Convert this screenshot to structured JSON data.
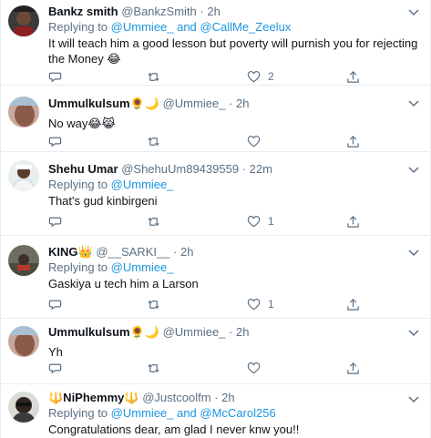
{
  "accent_color": "#1b95e0",
  "tweets": [
    {
      "name": "Bankz smith",
      "handle": "@BankzSmith",
      "dot": "·",
      "time": "2h",
      "replying_prefix": "Replying to ",
      "replying_to_1": "@Ummiee_",
      "replying_and": " and ",
      "replying_to_2": "@CallMe_Zeelux",
      "text": "It will teach him a good lesson but poverty will purnish you for rejecting the Money 😂",
      "reply_count": "",
      "retweet_count": "",
      "like_count": "2"
    },
    {
      "name": "Ummulkulsum🌻🌙",
      "handle": "@Ummiee_",
      "dot": "·",
      "time": "2h",
      "text": "No way😂😹",
      "reply_count": "",
      "retweet_count": "",
      "like_count": ""
    },
    {
      "name": "Shehu Umar",
      "handle": "@ShehuUm89439559",
      "dot": "·",
      "time": "22m",
      "replying_prefix": "Replying to ",
      "replying_to_1": "@Ummiee_",
      "text": "That's gud kinbirgeni",
      "reply_count": "",
      "retweet_count": "",
      "like_count": "1"
    },
    {
      "name": "KING👑",
      "handle": "@__SARKI__",
      "dot": "·",
      "time": "2h",
      "replying_prefix": "Replying to ",
      "replying_to_1": "@Ummiee_",
      "text": "Gaskiya u tech him a Larson",
      "reply_count": "",
      "retweet_count": "",
      "like_count": "1"
    },
    {
      "name": "Ummulkulsum🌻🌙",
      "handle": "@Ummiee_",
      "dot": "·",
      "time": "2h",
      "text": "Yh",
      "reply_count": "",
      "retweet_count": "",
      "like_count": ""
    },
    {
      "name": "🔱NiPhemmy🔱",
      "handle": "@Justcoolfm",
      "dot": "·",
      "time": "2h",
      "replying_prefix": "Replying to ",
      "replying_to_1": "@Ummiee_",
      "replying_and": " and ",
      "replying_to_2": "@McCarol256",
      "text": "Congratulations dear, am glad I never knw you!!"
    }
  ]
}
